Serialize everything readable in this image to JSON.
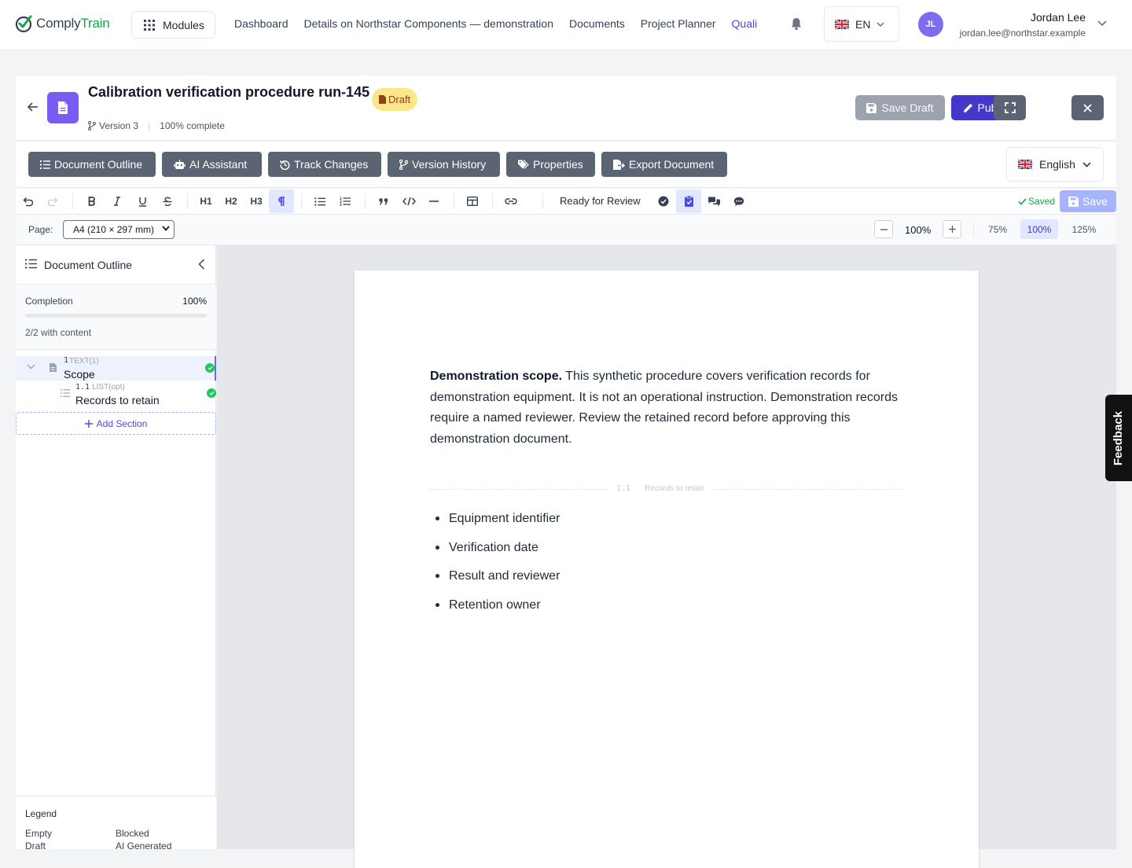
{
  "app": {
    "logo_part1": "Comply",
    "logo_part2": "Train"
  },
  "nav": {
    "modules_label": "Modules",
    "links": [
      "Dashboard",
      "Details on Northstar Components — demonstration",
      "Documents",
      "Project Planner"
    ],
    "active_link": "Quali",
    "language": "EN"
  },
  "user": {
    "initials": "JL",
    "name": "Jordan Lee",
    "email": "jordan.lee@northstar.example"
  },
  "document": {
    "title": "Calibration verification procedure run-145",
    "status_badge": "Draft",
    "version": "Version 3",
    "completion_text": "100% complete",
    "save_draft_label": "Save Draft",
    "publish_label": "Publish"
  },
  "tabs": [
    "Document Outline",
    "AI Assistant",
    "Track Changes",
    "Version History",
    "Properties",
    "Export Document"
  ],
  "content_language": "English",
  "toolbar": {
    "h1": "H1",
    "h2": "H2",
    "h3": "H3",
    "workflow_status": "Ready for Review",
    "saved_label": "Saved",
    "save_label": "Save"
  },
  "pagebar": {
    "page_label": "Page:",
    "page_size": "A4 (210 × 297 mm)",
    "zoom_value": "100%",
    "zoom_presets": [
      "75%",
      "100%",
      "125%"
    ],
    "active_preset": "100%"
  },
  "outline": {
    "title": "Document Outline",
    "completion_label": "Completion",
    "completion_value": "100%",
    "completion_fraction": 1.0,
    "with_content": "2/2 with content",
    "sections": [
      {
        "number": "1",
        "type": "TEXT(1)",
        "title": "Scope"
      },
      {
        "number": "1.1",
        "type": "LIST(opt)",
        "title": "Records to retain"
      }
    ],
    "add_section_label": "Add Section"
  },
  "legend": {
    "title": "Legend",
    "items": [
      "Empty",
      "Blocked",
      "Draft",
      "AI Generated"
    ]
  },
  "content": {
    "scope_lead": "Demonstration scope.",
    "scope_text": " This synthetic procedure covers verification records for demonstration equipment. It is not an operational instruction. Demonstration records require a named reviewer. Review the retained record before approving this demonstration document.",
    "section_number": "1.1",
    "section_title": "Records to retain",
    "bullets": [
      "Equipment identifier",
      "Verification date",
      "Result and reviewer",
      "Retention owner"
    ]
  },
  "feedback_label": "Feedback",
  "colors": {
    "accent": "#4f46e5",
    "publish": "#4338ca",
    "success": "#16a34a",
    "draft_badge": "#fde68a"
  }
}
